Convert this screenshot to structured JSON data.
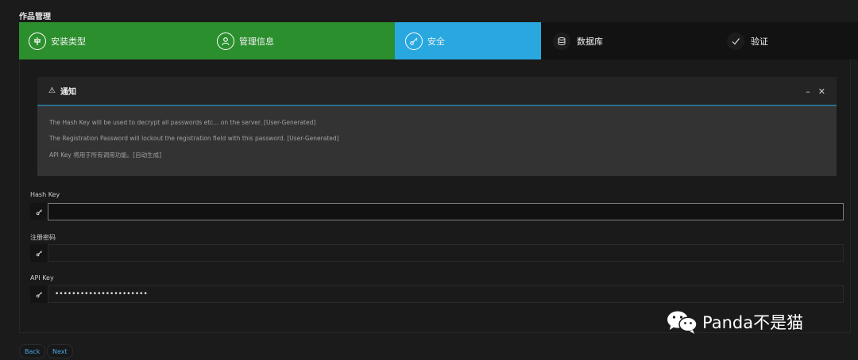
{
  "page_title": "作品管理",
  "steps": [
    {
      "label": "安装类型",
      "icon": "install-type-icon",
      "state": "done"
    },
    {
      "label": "管理信息",
      "icon": "user-icon",
      "state": "done"
    },
    {
      "label": "安全",
      "icon": "key-icon",
      "state": "active"
    },
    {
      "label": "数据库",
      "icon": "database-icon",
      "state": "pending"
    },
    {
      "label": "验证",
      "icon": "check-icon",
      "state": "pending"
    }
  ],
  "notice": {
    "title": "通知",
    "lines": [
      "The Hash Key will be used to decrypt all passwords etc... on the server. [User-Generated]",
      "The Registration Password will lockout the registration field with this password. [User-Generated]",
      "API Key 将用于所有调用功能。[自动生成]"
    ],
    "minimize": "–",
    "close": "✕"
  },
  "fields": {
    "hash_key": {
      "label": "Hash Key",
      "value": ""
    },
    "reg_password": {
      "label": "注册密码",
      "value": ""
    },
    "api_key": {
      "label": "API Key",
      "value": "••••••••••••••••••••••"
    }
  },
  "nav": {
    "back": "Back",
    "next": "Next"
  },
  "watermark": {
    "text": "Panda不是猫",
    "icon": "wechat-icon"
  },
  "colors": {
    "done": "#2c8f2e",
    "active": "#29a8e0",
    "pending": "#121212",
    "link": "#49a6e3"
  }
}
